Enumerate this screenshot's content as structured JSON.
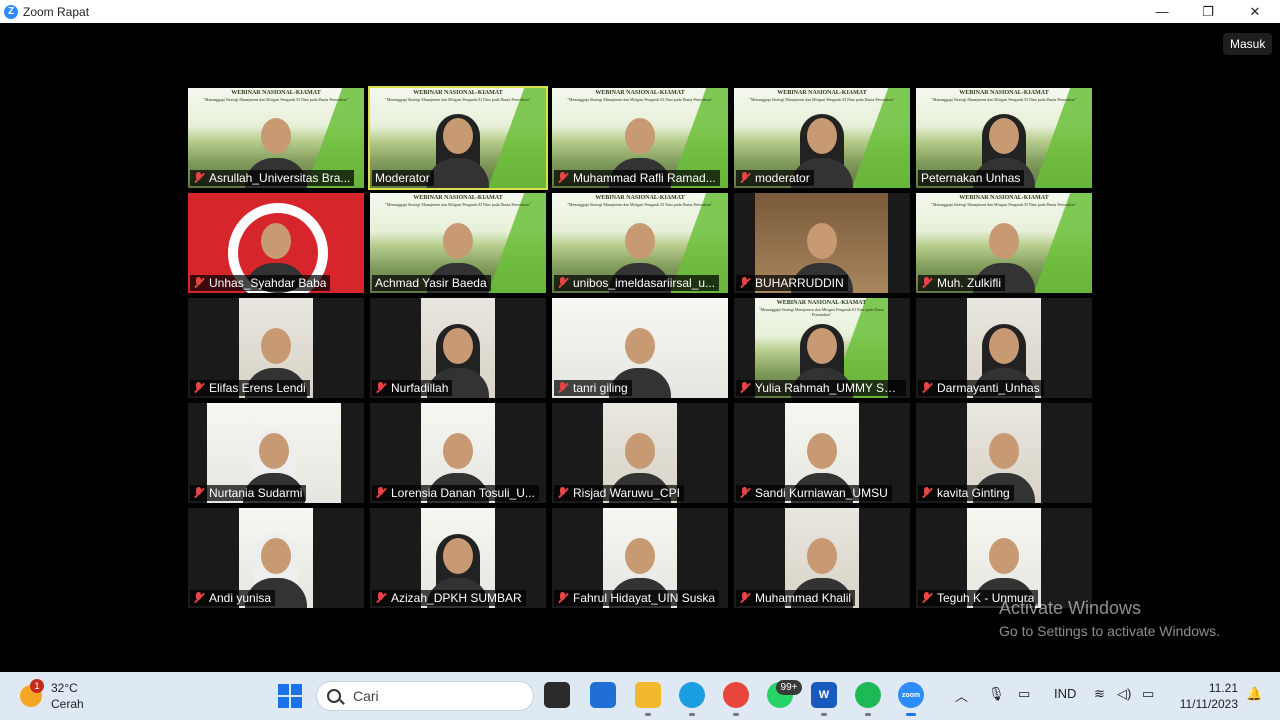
{
  "window": {
    "title": "Zoom Rapat",
    "logo": "Z",
    "controls": {
      "minimize": "—",
      "maximize": "❐",
      "close": "✕"
    }
  },
  "header": {
    "enter_label": "Masuk"
  },
  "participants": [
    {
      "name": "Asrullah_Universitas Bra...",
      "muted": true,
      "bg": "banner",
      "active": false
    },
    {
      "name": "Moderator",
      "muted": false,
      "bg": "banner",
      "active": true
    },
    {
      "name": "Muhammad Rafli Ramad...",
      "muted": true,
      "bg": "banner",
      "active": false
    },
    {
      "name": "moderator",
      "muted": true,
      "bg": "banner",
      "active": false
    },
    {
      "name": "Peternakan Unhas",
      "muted": false,
      "bg": "banner",
      "active": false
    },
    {
      "name": "Unhas_Syahdar Baba",
      "muted": true,
      "bg": "mac",
      "active": false
    },
    {
      "name": "Achmad Yasir Baeda",
      "muted": false,
      "bg": "banner",
      "active": false
    },
    {
      "name": "unibos_imeldasariirsal_u...",
      "muted": true,
      "bg": "banner",
      "active": false
    },
    {
      "name": "BUHARRUDDIN",
      "muted": true,
      "bg": "wood",
      "active": false
    },
    {
      "name": "Muh. Zulkifli",
      "muted": true,
      "bg": "banner",
      "active": false
    },
    {
      "name": "Elifas Erens Lendi",
      "muted": true,
      "bg": "indoor",
      "active": false
    },
    {
      "name": "Nurfadillah",
      "muted": true,
      "bg": "indoor",
      "active": false
    },
    {
      "name": "tanri giling",
      "muted": true,
      "bg": "wall",
      "active": false
    },
    {
      "name": "Yulia Rahmah_UMMY Sol...",
      "muted": true,
      "bg": "banner",
      "active": false
    },
    {
      "name": "Darmayanti_Unhas",
      "muted": true,
      "bg": "indoor",
      "active": false
    },
    {
      "name": "Nurtania Sudarmi",
      "muted": true,
      "bg": "wall",
      "active": false
    },
    {
      "name": "Lorensia Danan Tosuli_U...",
      "muted": true,
      "bg": "wall",
      "active": false
    },
    {
      "name": "Risjad Waruwu_CPI",
      "muted": true,
      "bg": "indoor",
      "active": false
    },
    {
      "name": "Sandi Kurniawan_UMSU",
      "muted": true,
      "bg": "wall",
      "active": false
    },
    {
      "name": "kavita Ginting",
      "muted": true,
      "bg": "indoor",
      "active": false
    },
    {
      "name": "Andi yunisa",
      "muted": true,
      "bg": "wall",
      "active": false
    },
    {
      "name": "Azizah_DPKH SUMBAR",
      "muted": true,
      "bg": "wall",
      "active": false
    },
    {
      "name": "Fahrul Hidayat_UIN Suska",
      "muted": true,
      "bg": "wall",
      "active": false
    },
    {
      "name": "Muhammad Khalil",
      "muted": true,
      "bg": "indoor",
      "active": false
    },
    {
      "name": "Teguh K - Unmura",
      "muted": true,
      "bg": "wall",
      "active": false
    }
  ],
  "banner": {
    "title": "WEBINAR NASIONAL-KIAMAT",
    "subtitle": "\"Menanggapi Strategi Manajemen dan Mitigasi Pengaruh El Nino pada Dunia Peternakan\""
  },
  "watermark": {
    "title": "Activate Windows",
    "subtitle": "Go to Settings to activate Windows."
  },
  "taskbar": {
    "weather": {
      "temp": "32°C",
      "condition": "Cerah",
      "badge": "1",
      "icon": "sun-icon"
    },
    "search_placeholder": "Cari",
    "whatsapp_badge": "99+",
    "apps": [
      "file-explorer-icon",
      "microsoft-store-icon",
      "folder-icon",
      "edge-icon",
      "chrome-icon",
      "whatsapp-icon",
      "word-icon",
      "spotify-icon",
      "zoom-icon"
    ],
    "tray": {
      "language": "IND",
      "icons": [
        "chevron-up-icon",
        "mic-icon",
        "display-icon",
        "wifi-icon",
        "volume-icon",
        "battery-icon",
        "bell-icon"
      ]
    },
    "clock": {
      "time": "11.21",
      "date": "11/11/2023"
    }
  }
}
